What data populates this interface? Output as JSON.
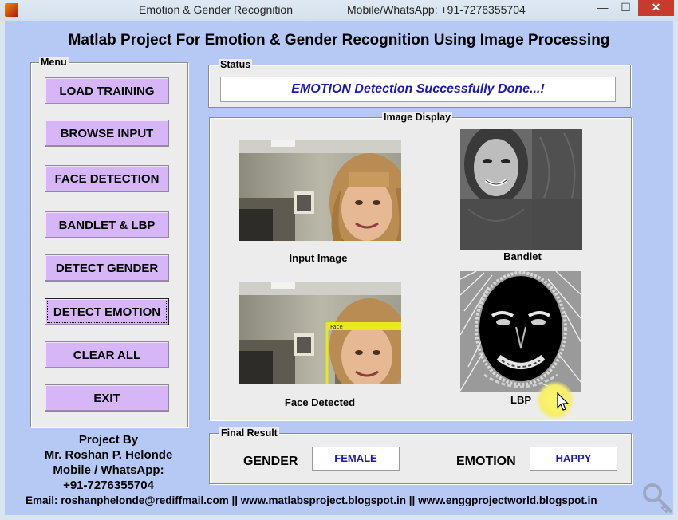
{
  "window": {
    "title": "Emotion & Gender Recognition",
    "subtitle": "Mobile/WhatsApp: +91-7276355704",
    "controls": {
      "minimize": "—",
      "maximize": "☐",
      "close": "✕"
    }
  },
  "heading": "Matlab Project For Emotion & Gender Recognition Using Image Processing",
  "menu": {
    "title": "Menu",
    "buttons": [
      {
        "label": "LOAD TRAINING"
      },
      {
        "label": "BROWSE INPUT"
      },
      {
        "label": "FACE DETECTION"
      },
      {
        "label": "BANDLET & LBP"
      },
      {
        "label": "DETECT GENDER"
      },
      {
        "label": "DETECT EMOTION"
      },
      {
        "label": "CLEAR ALL"
      },
      {
        "label": "EXIT"
      }
    ]
  },
  "status": {
    "title": "Status",
    "text": "EMOTION Detection Successfully Done...!"
  },
  "image_display": {
    "title": "Image Display",
    "captions": {
      "input": "Input Image",
      "bandlet": "Bandlet",
      "face": "Face Detected",
      "lbp": "LBP"
    }
  },
  "result": {
    "title": "Final Result",
    "gender_label": "GENDER",
    "gender_value": "FEMALE",
    "emotion_label": "EMOTION",
    "emotion_value": "HAPPY"
  },
  "project_by": {
    "line1": "Project By",
    "line2": "Mr. Roshan P. Helonde",
    "line3": "Mobile / WhatsApp:",
    "line4": "+91-7276355704"
  },
  "footer": "Email: roshanphelonde@rediffmail.com ||  www.matlabsproject.blogspot.in || www.enggprojectworld.blogspot.in",
  "icons": {
    "app": "matlab-logo-icon",
    "cursor": "mouse-pointer-icon",
    "watermark": "key-watermark-icon"
  }
}
